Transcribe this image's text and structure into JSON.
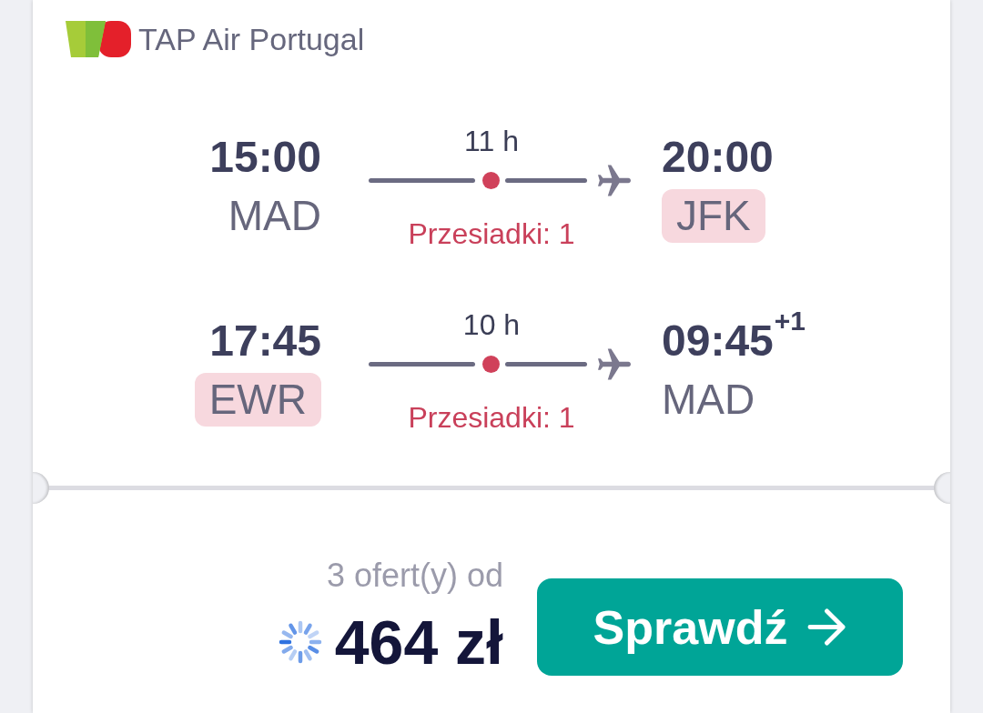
{
  "airline": {
    "name": "TAP Air Portugal"
  },
  "legs": [
    {
      "departure": {
        "time": "15:00",
        "airport": "MAD",
        "highlighted": false
      },
      "duration": "11 h",
      "stops": "Przesiadki: 1",
      "arrival": {
        "time": "20:00",
        "airport": "JFK",
        "highlighted": true
      }
    },
    {
      "departure": {
        "time": "17:45",
        "airport": "EWR",
        "highlighted": true
      },
      "duration": "10 h",
      "stops": "Przesiadki: 1",
      "arrival": {
        "time": "09:45",
        "day_offset": "+1",
        "airport": "MAD",
        "highlighted": false
      }
    }
  ],
  "price": {
    "offers": "3 ofert(y) od",
    "amount": "464 zł",
    "loading": true
  },
  "cta_button": {
    "label": "Sprawdź"
  }
}
